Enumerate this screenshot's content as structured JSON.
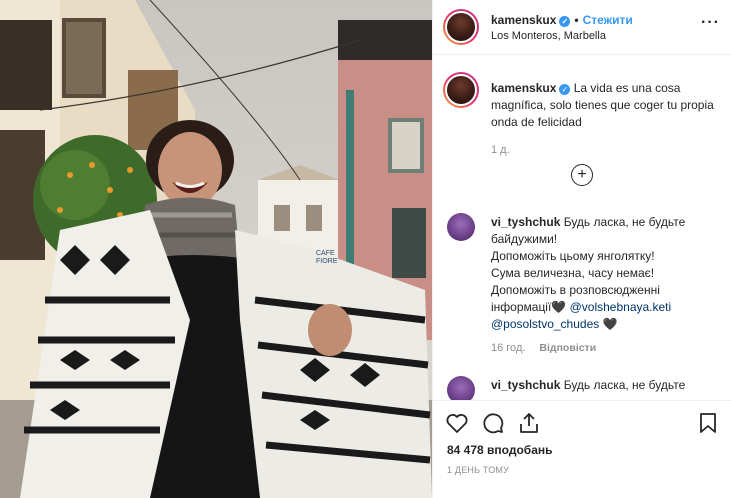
{
  "post": {
    "username": "kamenskux",
    "verified_mark": "✓",
    "separator": "•",
    "follow_label": "Стежити",
    "location": "Los Monteros, Marbella",
    "more_glyph": "···"
  },
  "caption": {
    "username": "kamenskux",
    "text": "La vida es una cosa magnífica, solo tienes que coger tu propia onda de felicidad",
    "age": "1 д.",
    "load_more_glyph": "+"
  },
  "comments": [
    {
      "username": "vi_tyshchuk",
      "text_lines": [
        "Будь ласка, не будьте",
        "байдужими!",
        "Допоможіть цьому янголятку!",
        "Сума величезна, часу немає!",
        "Допоможіть в розповсюдженні",
        "інформації🖤"
      ],
      "mention_1": "@volshebnaya.keti",
      "mention_2": "@posolstvo_chudes",
      "trailing": "🖤",
      "time": "16 год.",
      "reply_label": "Відповісти"
    },
    {
      "username": "vi_tyshchuk",
      "text_lines": [
        "Будь ласка, не будьте"
      ]
    }
  ],
  "actions": {
    "icons": [
      "heart-icon",
      "comment-icon",
      "share-icon",
      "bookmark-icon"
    ],
    "likes": "84 478 вподобань",
    "posted_ago": "1 ДЕНЬ ТОМУ"
  },
  "photo": {
    "sign_text": "CAFE FIORE"
  },
  "colors": {
    "accent": "#3897f0",
    "muted": "#8e8e8e",
    "text": "#262626",
    "border": "#efefef"
  }
}
